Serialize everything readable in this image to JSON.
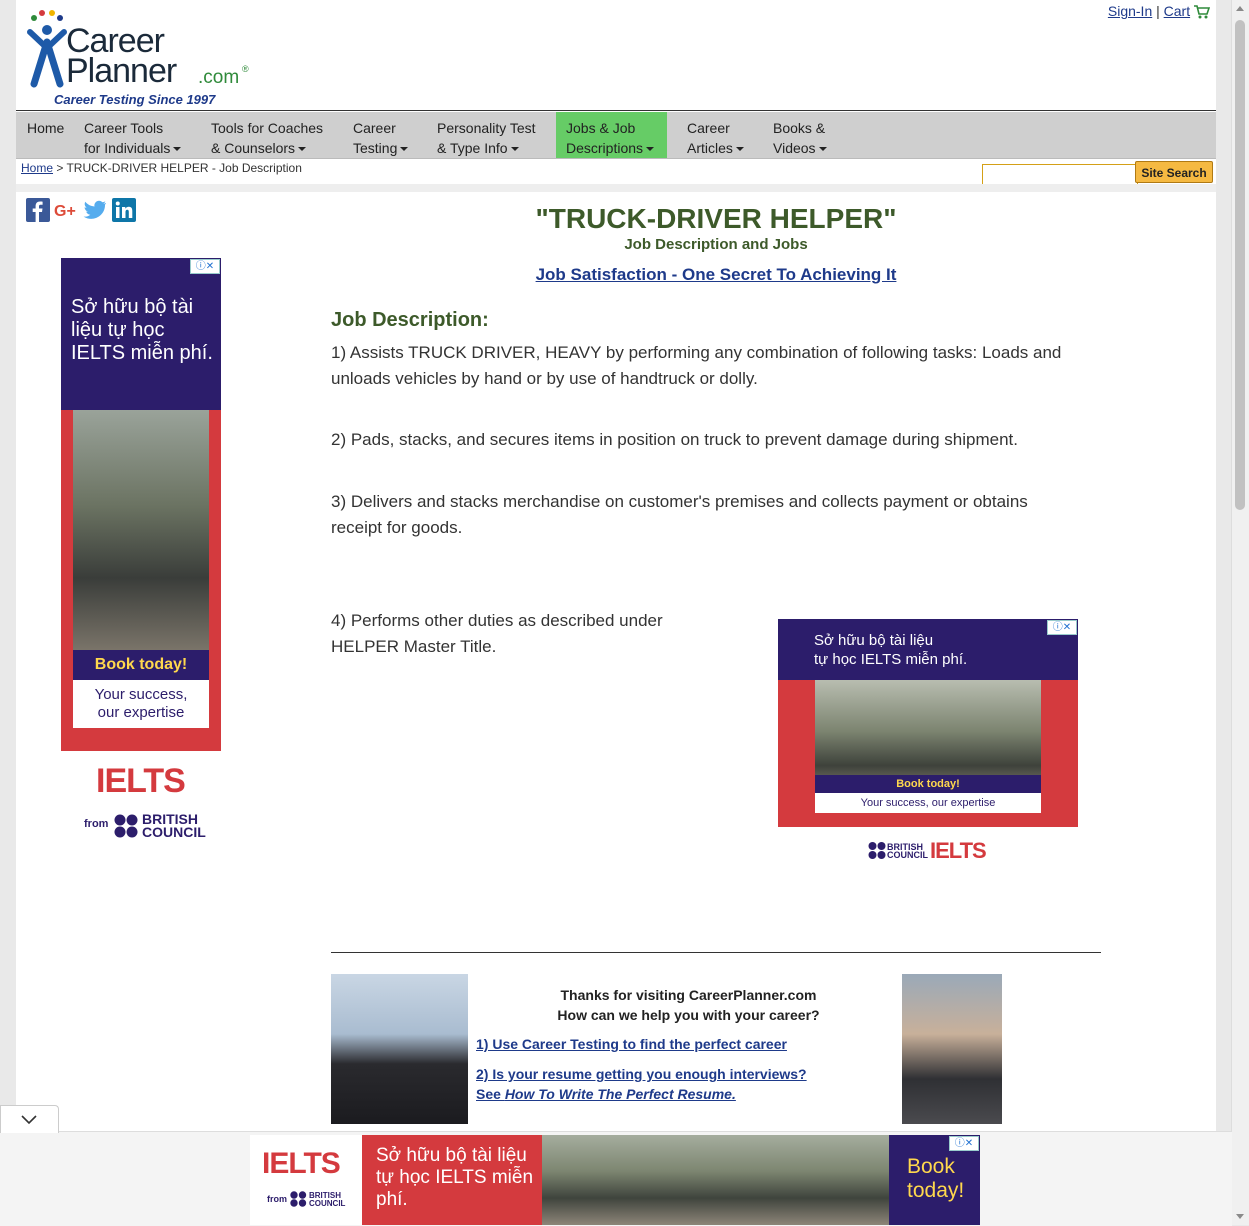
{
  "header": {
    "logo_line1": "Career",
    "logo_line2": "Planner",
    "logo_dotcom": ".com",
    "logo_reg": "®",
    "tagline": "Career Testing Since 1997",
    "signin": "Sign-In",
    "separator": "|",
    "cart": "Cart"
  },
  "nav": {
    "items": [
      {
        "line1": "Home",
        "line2": ""
      },
      {
        "line1": "Career Tools",
        "line2": "for Individuals"
      },
      {
        "line1": "Tools for Coaches",
        "line2": "& Counselors"
      },
      {
        "line1": "Career",
        "line2": "Testing"
      },
      {
        "line1": "Personality Test",
        "line2": "& Type Info"
      },
      {
        "line1": "Jobs & Job",
        "line2": "Descriptions"
      },
      {
        "line1": "Career",
        "line2": "Articles"
      },
      {
        "line1": "Books &",
        "line2": "Videos"
      }
    ],
    "active_index": 5
  },
  "breadcrumb": {
    "home": "Home",
    "rest": " > TRUCK-DRIVER HELPER - Job Description"
  },
  "search": {
    "value": "",
    "button": "Site Search"
  },
  "social": [
    "facebook-icon",
    "google-plus-icon",
    "twitter-icon",
    "linkedin-icon"
  ],
  "ads": {
    "left": {
      "text": "Sở hữu bộ tài liệu tự học IELTS miễn phí.",
      "book": "Book today!",
      "success_line1": "Your success,",
      "success_line2": "our expertise",
      "ielts": "IELTS",
      "from": "from",
      "bc_line1": "BRITISH",
      "bc_line2": "COUNCIL"
    },
    "right": {
      "text_line1": "Sở hữu bộ tài liệu",
      "text_line2": "tự học IELTS miễn phí.",
      "book": "Book today!",
      "success": "Your success, our expertise",
      "ielts": "IELTS",
      "bc_line1": "BRITISH",
      "bc_line2": "COUNCIL"
    },
    "bottom": {
      "ielts": "IELTS",
      "from": "from",
      "bc_line1": "BRITISH",
      "bc_line2": "COUNCIL",
      "text": "Sở hữu bộ tài liệu tự học IELTS miễn phí.",
      "book": "Book today!"
    },
    "adchoices": "ⓘ✕"
  },
  "main": {
    "title": "\"TRUCK-DRIVER HELPER\"",
    "subtitle": "Job Description and Jobs",
    "satisfaction_link": "Job Satisfaction - One Secret To Achieving It",
    "jd_heading": "Job Description:",
    "duties": [
      "1) Assists TRUCK DRIVER, HEAVY by performing any combination of following tasks: Loads and unloads vehicles by hand or by use of handtruck or dolly.",
      "2) Pads, stacks, and secures items in position on truck to prevent damage during shipment.",
      "3) Delivers and stacks merchandise on customer's premises and collects payment or obtains receipt for goods.",
      "4) Performs other duties as described under HELPER Master Title."
    ]
  },
  "footer_promo": {
    "thanks_line1": "Thanks for visiting CareerPlanner.com",
    "thanks_line2": "How can we help you with your career?",
    "link1": "1) Use Career Testing to find the perfect career",
    "link2": "2) Is your resume getting you enough interviews?",
    "link3_prefix": "See ",
    "link3_italic": "How To Write The Perfect Resume."
  }
}
